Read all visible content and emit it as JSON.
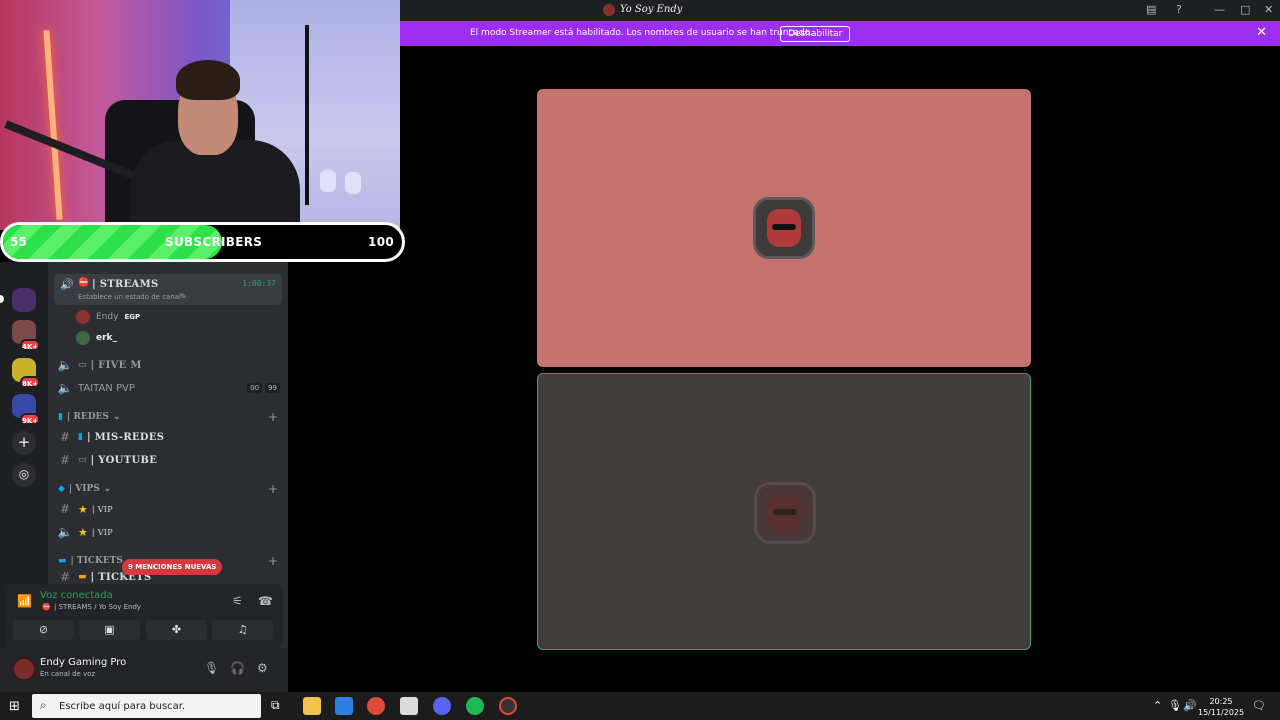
{
  "overlay": {
    "sub_current": "55",
    "sub_label": "SUBSCRIBERS",
    "sub_goal": "100",
    "sub_progress": 0.55
  },
  "titlebar": {
    "server_title": "Yo Soy Endy"
  },
  "banner": {
    "text": "El modo Streamer está habilitado. Los nombres de usuario se han truncado.",
    "button": "Deshabilitar"
  },
  "guild_badges": [
    "4K+",
    "8K+",
    "9K+"
  ],
  "channels": {
    "active": {
      "name": "| STREAMS",
      "status": "Establece un estado de canal",
      "timer": "1:00:37"
    },
    "voice_users": [
      {
        "name": "Endy",
        "tag": "EGP"
      },
      {
        "name": "erk_",
        "tag": ""
      }
    ],
    "five_m": "| FIVE M",
    "taitan": {
      "name": "TAITAN PVP",
      "count_a": "00",
      "count_b": "99"
    },
    "cat_redes": "| REDES",
    "mis_redes": "| MIS-REDES",
    "youtube": "| YOUTUBE",
    "cat_vips": "| VIPS",
    "vip_text": "| VIP",
    "vip_voice": "| VIP",
    "cat_tickets": "| TICKETS",
    "tickets_partial": "| TICKETS",
    "mentions": "9 MENCIONES NUEVAS"
  },
  "voice_panel": {
    "title": "Voz conectada",
    "channel": "| STREAMS / Yo Soy Endy"
  },
  "user": {
    "name": "Endy Gaming Pro",
    "status": "En canal de voz"
  },
  "taskbar": {
    "search_placeholder": "Escribe aquí para buscar.",
    "time": "20:25",
    "date": "15/11/2025"
  },
  "colors": {
    "accent_banner": "#9b2eef",
    "voice_green": "#23a559",
    "tile_speaker": "#c4736e"
  }
}
